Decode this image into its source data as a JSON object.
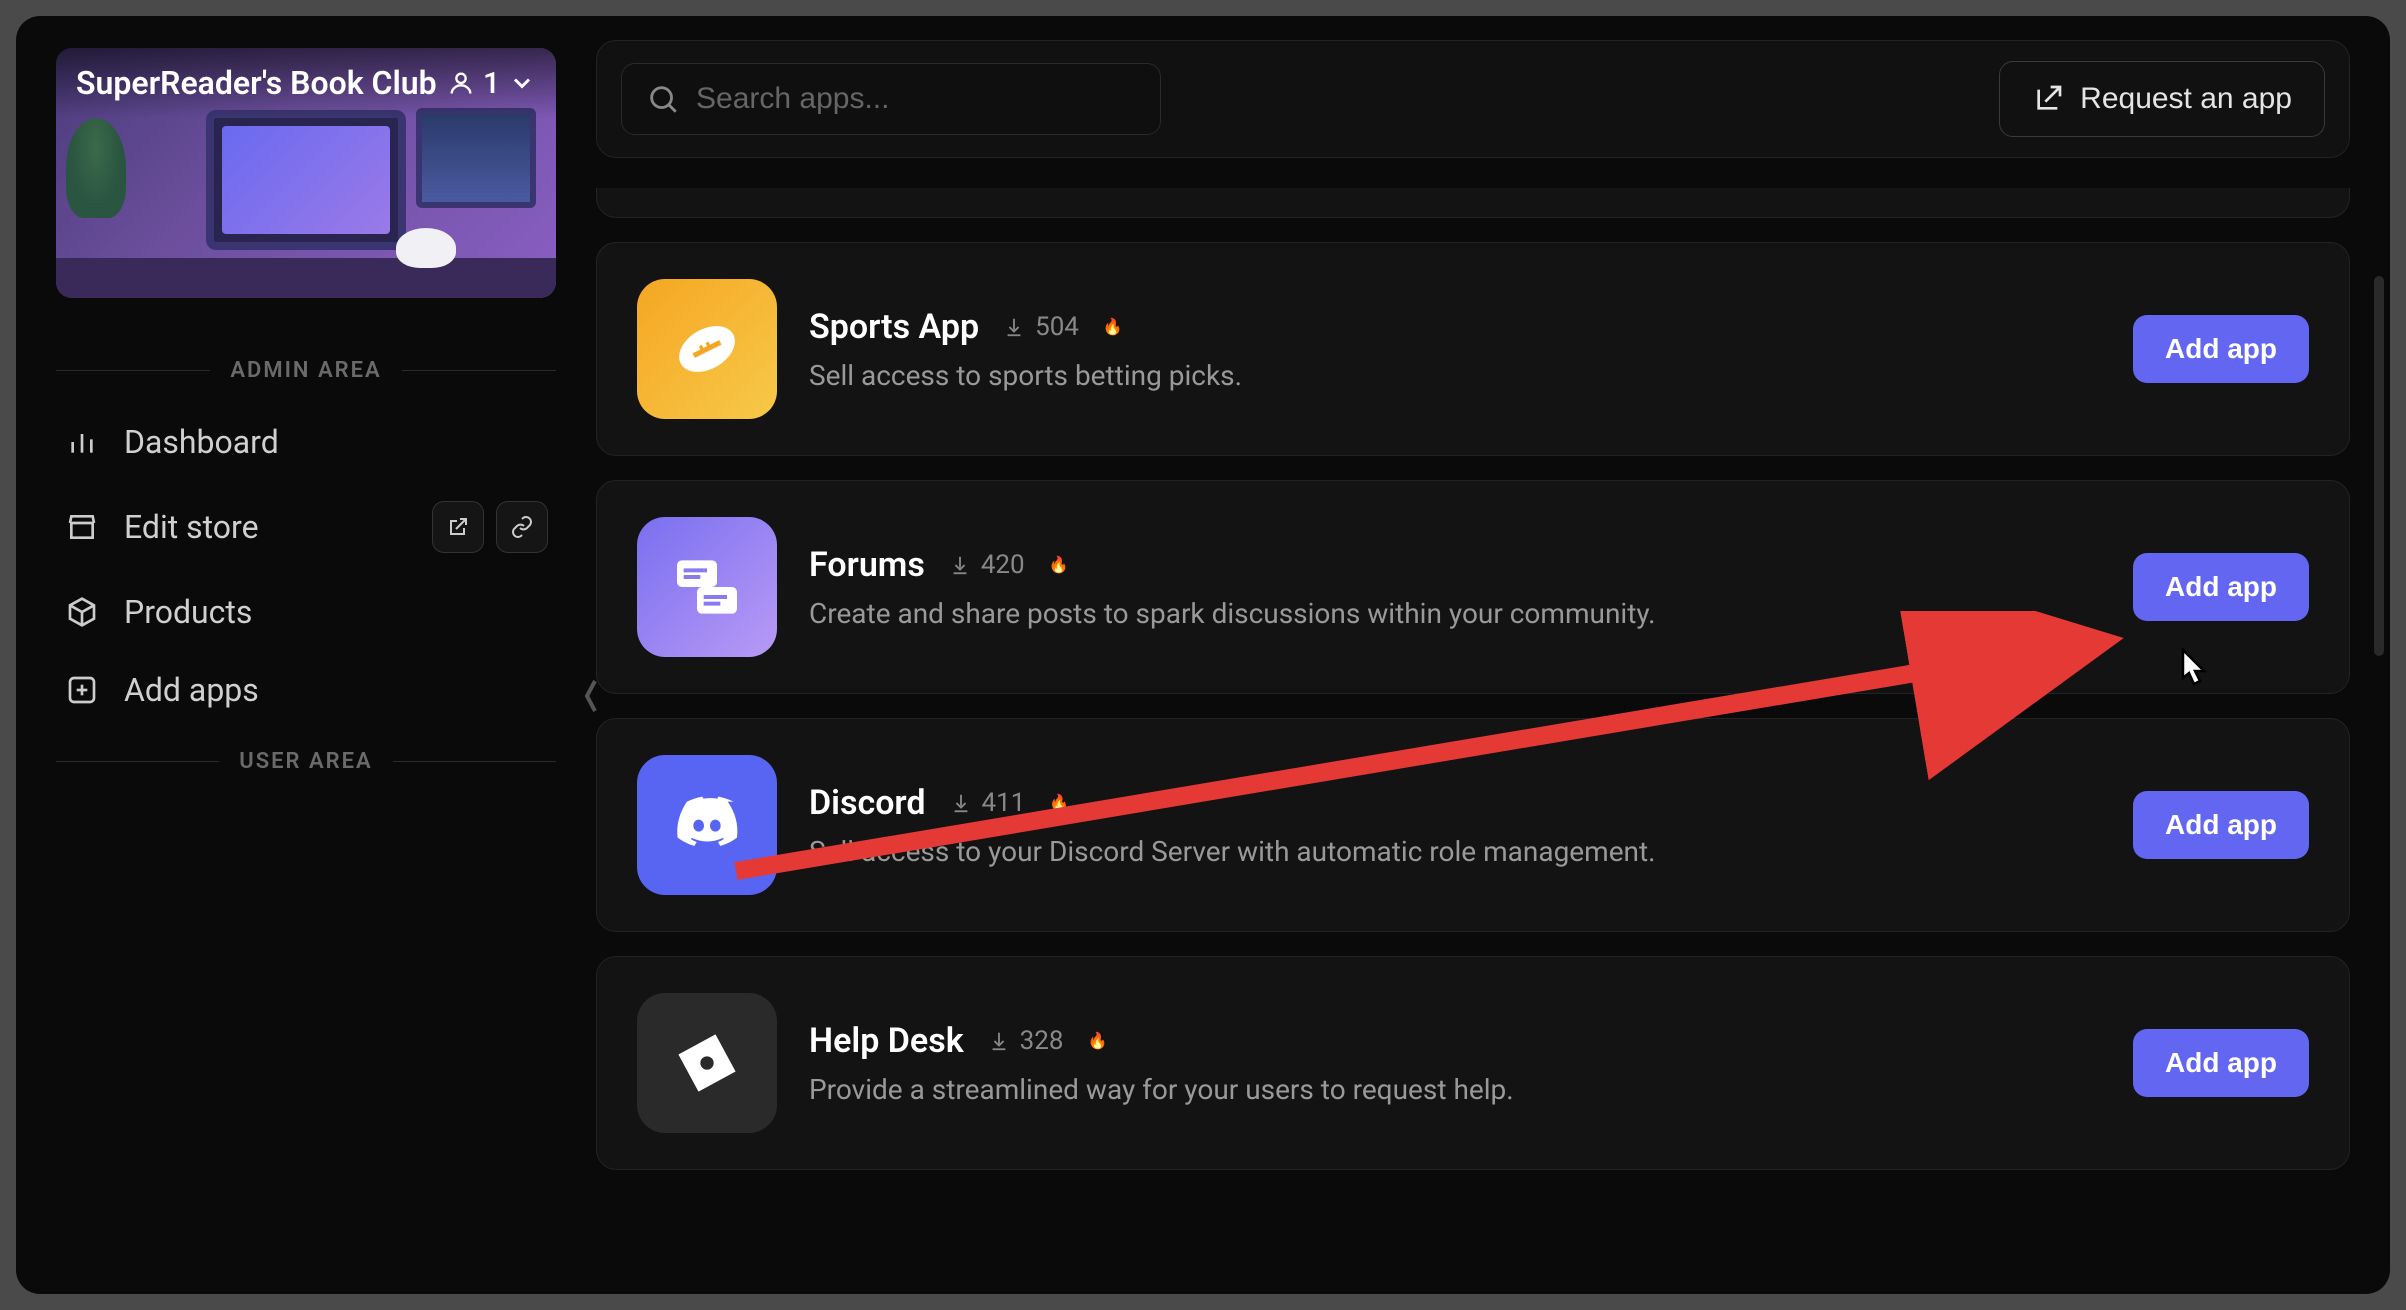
{
  "sidebar": {
    "server_name": "SuperReader's Book Club",
    "member_count": "1",
    "sections": {
      "admin": "ADMIN AREA",
      "user": "USER AREA"
    },
    "nav": {
      "dashboard": "Dashboard",
      "edit_store": "Edit store",
      "products": "Products",
      "add_apps": "Add apps"
    }
  },
  "header": {
    "search_placeholder": "Search apps...",
    "request_label": "Request an app"
  },
  "apps": [
    {
      "name": "Sports App",
      "downloads": "504",
      "trending": true,
      "description": "Sell access to sports betting picks.",
      "add_label": "Add app",
      "icon": "sports"
    },
    {
      "name": "Forums",
      "downloads": "420",
      "trending": true,
      "description": "Create and share posts to spark discussions within your community.",
      "add_label": "Add app",
      "icon": "forums"
    },
    {
      "name": "Discord",
      "downloads": "411",
      "trending": true,
      "description": "Sell access to your Discord Server with automatic role management.",
      "add_label": "Add app",
      "icon": "discord"
    },
    {
      "name": "Help Desk",
      "downloads": "328",
      "trending": true,
      "description": "Provide a streamlined way for your users to request help.",
      "add_label": "Add app",
      "icon": "help"
    }
  ],
  "annotation": {
    "arrow_color": "#e53935",
    "target": "forums-add-button"
  }
}
